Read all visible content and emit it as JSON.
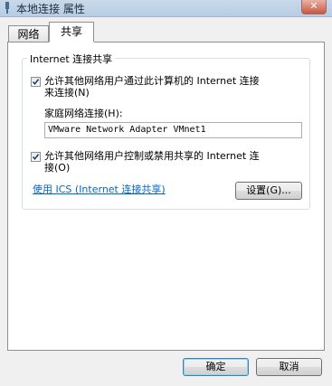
{
  "window": {
    "title": "本地连接 属性",
    "close_label": "✕"
  },
  "tabs": [
    {
      "label": "网络"
    },
    {
      "label": "共享"
    }
  ],
  "group": {
    "title": "Internet 连接共享",
    "allow_sharing": {
      "checked": true,
      "label_line1": "允许其他网络用户通过此计算机的 Internet 连接",
      "label_line2": "来连接(N)"
    },
    "home_network": {
      "label": "家庭网络连接(H):",
      "value": "VMware Network Adapter VMnet1"
    },
    "allow_control": {
      "checked": true,
      "label_line1": "允许其他网络用户控制或禁用共享的 Internet 连",
      "label_line2": "接(O)"
    },
    "ics_link": "使用 ICS (Internet 连接共享)",
    "settings_button": "设置(G)..."
  },
  "footer": {
    "ok_button": "确定",
    "cancel_button": "取消"
  }
}
